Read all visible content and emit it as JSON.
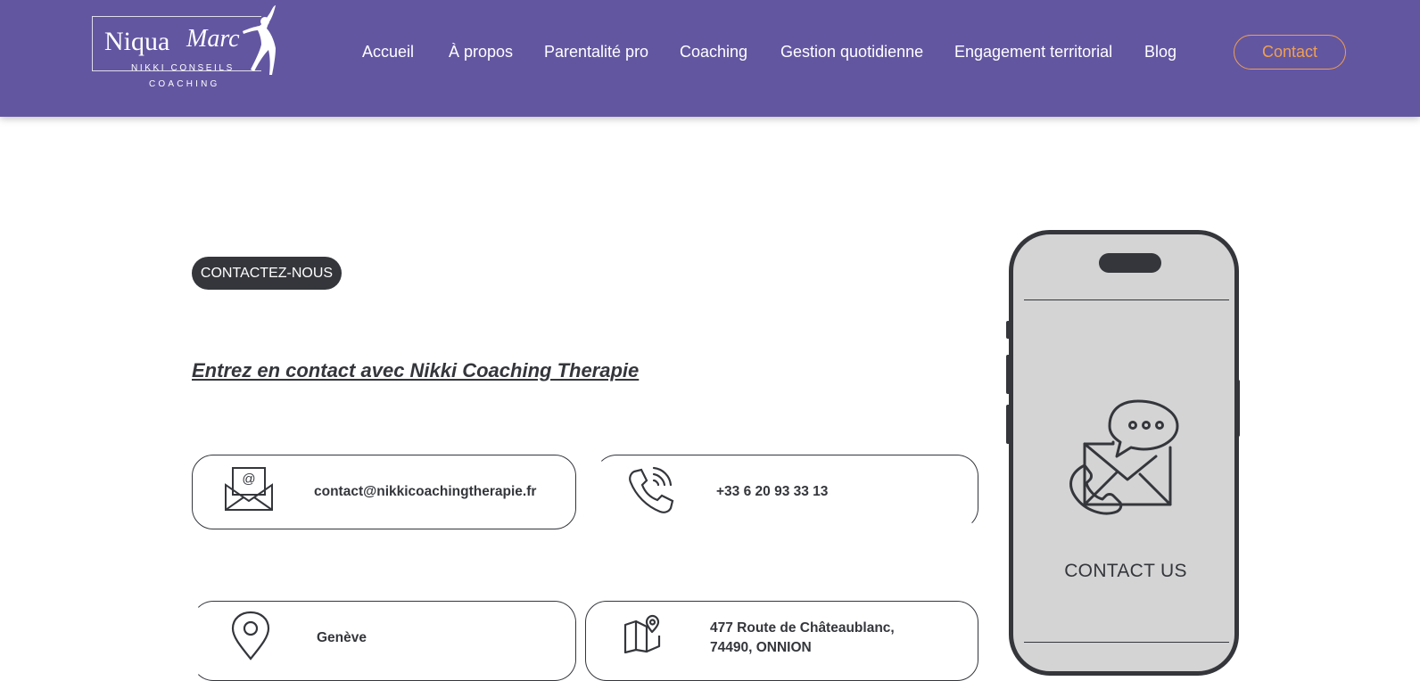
{
  "header": {
    "logo": {
      "brand": "Niqua",
      "script": "Marc",
      "line1": "NIKKI CONSEILS",
      "line2": "COACHING"
    },
    "nav": [
      "Accueil",
      "À propos",
      "Parentalité pro",
      "Coaching",
      "Gestion quotidienne",
      "Engagement territorial",
      "Blog"
    ],
    "contact_button": "Contact",
    "background_color": "#6356a1",
    "accent_color": "#f0a050"
  },
  "main": {
    "tag": "CONTACTEZ-NOUS",
    "heading": "Entrez en contact avec Nikki Coaching Therapie",
    "cards": [
      {
        "icon": "email-envelope-icon",
        "text": "contact@nikkicoachingtherapie.fr"
      },
      {
        "icon": "phone-ringing-icon",
        "text": "+33 6 20 93 33 13"
      },
      {
        "icon": "location-pin-icon",
        "text": "Genève"
      },
      {
        "icon": "map-icon",
        "line1": "477 Route de Châteaublanc,",
        "line2": "74490, ONNION"
      }
    ]
  },
  "phone_illustration": {
    "label": "CONTACT US",
    "icon": "contact-chat-envelope-icon"
  }
}
